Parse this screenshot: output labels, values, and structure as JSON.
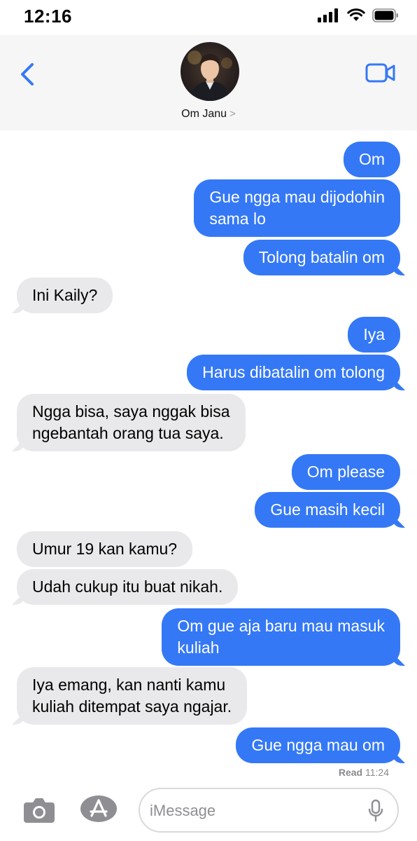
{
  "status_bar": {
    "time": "12:16"
  },
  "header": {
    "contact_name": "Om Janu",
    "contact_chevron": ">"
  },
  "messages": [
    {
      "dir": "out",
      "text": "Om"
    },
    {
      "dir": "out",
      "text": "Gue ngga mau dijodohin\nsama lo"
    },
    {
      "dir": "out",
      "text": "Tolong batalin om"
    },
    {
      "dir": "in",
      "text": "Ini Kaily?"
    },
    {
      "dir": "out",
      "text": "Iya"
    },
    {
      "dir": "out",
      "text": "Harus dibatalin om tolong"
    },
    {
      "dir": "in",
      "text": "Ngga bisa, saya nggak bisa\nngebantah orang tua saya."
    },
    {
      "dir": "out",
      "text": "Om please"
    },
    {
      "dir": "out",
      "text": "Gue masih kecil"
    },
    {
      "dir": "in",
      "text": "Umur 19 kan kamu?"
    },
    {
      "dir": "in",
      "text": "Udah cukup itu buat nikah."
    },
    {
      "dir": "out",
      "text": "Om gue aja baru mau masuk\nkuliah"
    },
    {
      "dir": "in",
      "text": "Iya emang, kan nanti kamu\nkuliah ditempat saya ngajar."
    },
    {
      "dir": "out",
      "text": "Gue ngga mau om"
    }
  ],
  "read_receipt": {
    "label": "Read",
    "time": "11:24"
  },
  "input_bar": {
    "placeholder": "iMessage"
  },
  "icons": {
    "back": "chevron-left-icon",
    "video": "video-camera-icon",
    "camera": "camera-icon",
    "app_store": "app-store-icon",
    "mic": "microphone-icon",
    "signal": "cellular-signal-icon",
    "wifi": "wifi-icon",
    "battery": "battery-icon"
  },
  "colors": {
    "outgoing_bubble": "#3478f6",
    "incoming_bubble": "#e9e9eb",
    "accent": "#3478f6"
  }
}
